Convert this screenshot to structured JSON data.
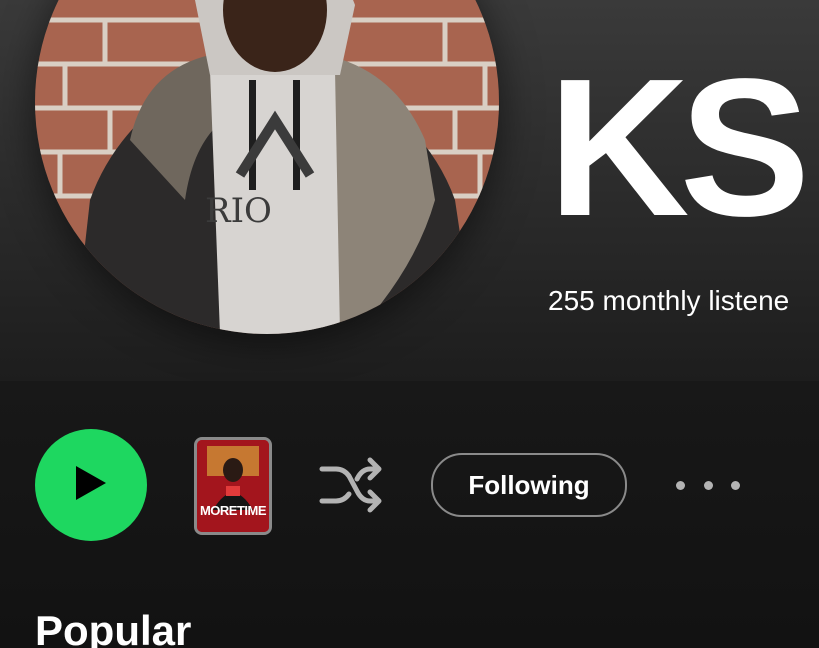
{
  "artist": {
    "name": "KS",
    "monthly_listeners": "255 monthly listene"
  },
  "actions": {
    "play_icon": "play-icon",
    "preview_thumb_text": "MORETIME",
    "shuffle_icon": "shuffle-icon",
    "following_label": "Following",
    "more_icon": "more-options-icon"
  },
  "sections": {
    "popular_title": "Popular"
  },
  "colors": {
    "accent": "#1ed760",
    "background": "#121212",
    "header_gradient_top": "#3a3a3a"
  }
}
